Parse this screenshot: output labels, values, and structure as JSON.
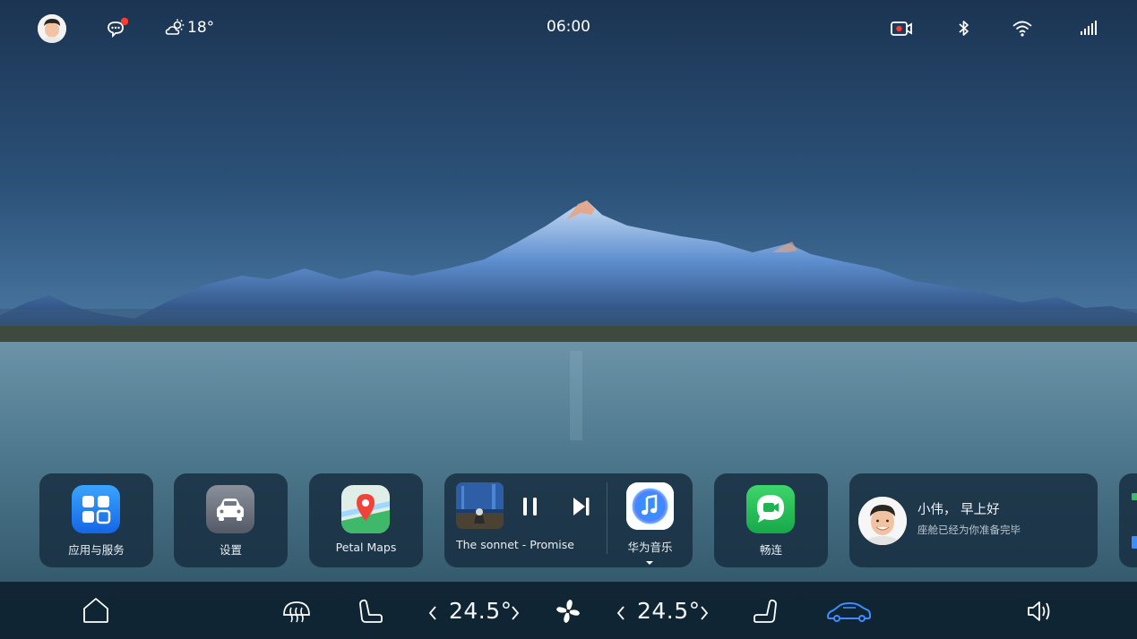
{
  "status_bar": {
    "weather_temp": "18°",
    "time": "06:00",
    "icons": [
      "avatar",
      "message-icon",
      "weather-cloud-sun-icon",
      "record-icon",
      "bluetooth-icon",
      "wifi-icon",
      "signal-icon"
    ]
  },
  "cards": {
    "apps": {
      "label": "应用与服务",
      "icon": "apps-grid-icon"
    },
    "settings": {
      "label": "设置",
      "icon": "car-settings-icon"
    },
    "maps": {
      "label": "Petal Maps",
      "icon": "map-pin-icon"
    },
    "music": {
      "song": "The sonnet - Promise",
      "app_label": "华为音乐",
      "icons": [
        "pause-icon",
        "next-icon",
        "music-note-icon"
      ]
    },
    "changlian": {
      "label": "畅连",
      "icon": "video-call-icon"
    },
    "greeting": {
      "name_line": "小伟， 早上好",
      "sub_line": "座舱已经为你准备完毕"
    }
  },
  "dock": {
    "left_temp": "24.5°",
    "right_temp": "24.5°",
    "icons": [
      "home-icon",
      "defrost-icon",
      "seat-left-icon",
      "fan-icon",
      "seat-right-icon",
      "car-icon",
      "volume-icon"
    ]
  },
  "colors": {
    "accent_blue": "#3f8cff",
    "notification_red": "#ff3b30",
    "card_bg": "#162c3e"
  }
}
